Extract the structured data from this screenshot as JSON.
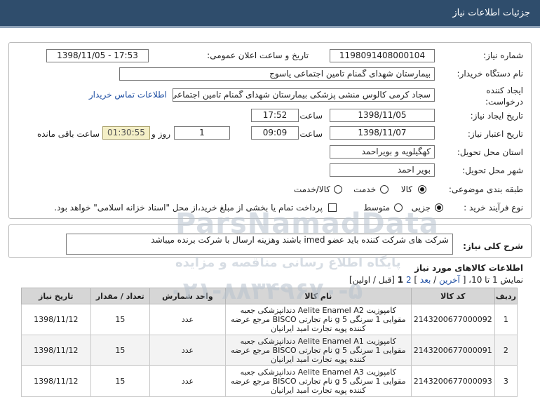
{
  "header": {
    "title": "جزئیات اطلاعات نیاز"
  },
  "form": {
    "need_number_label": "شماره نیاز:",
    "need_number": "1198091408000104",
    "announce_label": "تاریخ و ساعت اعلان عمومی:",
    "announce_value": "1398/11/05 - 17:53",
    "buyer_label": "نام دستگاه خریدار:",
    "buyer_value": "بیمارستان شهدای گمنام تامین اجتماعی یاسوج",
    "creator_label_line1": "ایجاد کننده",
    "creator_label_line2": "درخواست:",
    "creator_value": "سجاد کرمی کالوس  منشی پزشکی  بیمارستان شهدای گمنام تامین اجتماعی",
    "contact_link": "اطلاعات تماس خریدار",
    "create_date_label": "تاریخ ایجاد نیاز:",
    "create_date": "1398/11/05",
    "hour_label": "ساعت",
    "create_time": "17:52",
    "validity_label": "تاریخ اعتبار نیاز:",
    "validity_date": "1398/11/07",
    "validity_time": "09:09",
    "days_value": "1",
    "days_label": "روز و",
    "remaining_time": "01:30:55",
    "remaining_label": "ساعت باقی مانده",
    "province_label": "استان محل تحویل:",
    "province_value": "کهگیلویه و بویراحمد",
    "city_label": "شهر محل تحویل:",
    "city_value": "بویر احمد",
    "category_label": "طبقه بندی موضوعی:",
    "category_options": [
      "کالا",
      "خدمت",
      "کالا/خدمت"
    ],
    "category_selected": "کالا",
    "process_label": "نوع فرآیند خرید :",
    "process_options": [
      "جزیی",
      "متوسط"
    ],
    "process_selected": "جزیی",
    "payment_note": "پرداخت تمام یا بخشی از مبلغ خرید،از محل \"اسناد خزانه اسلامی\" خواهد بود."
  },
  "description": {
    "label": "شرح کلی نیاز:",
    "text": "شرکت های شرکت کننده باید عضو imed باشند وهزینه ارسال با شرکت برنده میباشد"
  },
  "goods": {
    "title": "اطلاعات کالاهای مورد نیاز",
    "pager_prefix": "نمایش 1 تا 10، [",
    "pager_last": "آخرین",
    "pager_next": "بعد",
    "pager_page2": "2",
    "pager_page1": "1",
    "pager_suffix": "[قبل / اولین]",
    "columns": [
      "ردیف",
      "کد کالا",
      "نام کالا",
      "واحد شمارش",
      "تعداد / مقدار",
      "تاریخ نیاز"
    ],
    "rows": [
      {
        "row": "1",
        "code": "2143200677000092",
        "name": "کامپوزیت Aelite Enamel A2 دندانپزشکی جعبه مقوایی 1 سرنگی 5 g نام تجارتی BISCO مرجع عرضه کننده پویه تجارت امید ایرانیان",
        "unit": "عدد",
        "qty": "15",
        "date": "1398/11/12"
      },
      {
        "row": "2",
        "code": "2143200677000091",
        "name": "کامپوزیت Aelite Enamel A1 دندانپزشکی جعبه مقوایی 1 سرنگی 5 g نام تجارتی BISCO مرجع عرضه کننده پویه تجارت امید ایرانیان",
        "unit": "عدد",
        "qty": "15",
        "date": "1398/11/12"
      },
      {
        "row": "3",
        "code": "2143200677000093",
        "name": "کامپوزیت Aelite Enamel A3 دندانپزشکی جعبه مقوایی 1 سرنگی 5 g نام تجارتی BISCO مرجع عرضه کننده پویه تجارت امید ایرانیان",
        "unit": "عدد",
        "qty": "15",
        "date": "1398/11/12"
      }
    ]
  },
  "watermark": {
    "line1": "ParsNamadData",
    "line2": "پایگاه اطلاع رسانی مناقصه و مزایده",
    "line3": "۰۲۱-۸۸۳۴۹۶۷۰-۵"
  },
  "colors": {
    "header_bg": "#2f4d6c",
    "timer_bg": "#f4efc6",
    "link": "#1f4fa3",
    "table_header": "#d6d6d6"
  }
}
